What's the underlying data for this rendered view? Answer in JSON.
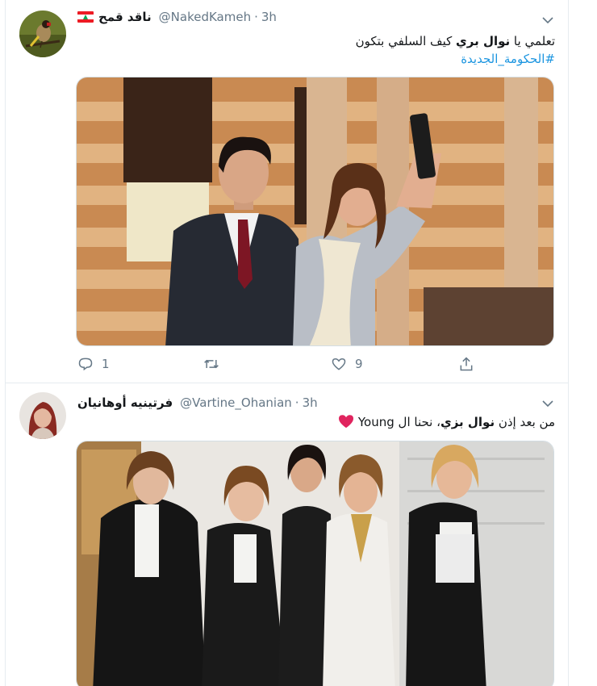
{
  "tweets": [
    {
      "display_name": "ناقد قمح",
      "handle": "@NakedKameh",
      "separator": "·",
      "time": "3h",
      "text_before": "تعلمي يا ",
      "text_bold": "نوال بري",
      "text_after": " كيف السلفي بتكون",
      "hashtag": "#الحكومة_الجديدة",
      "actions": {
        "replies": "1",
        "retweets": "",
        "likes": "9"
      }
    },
    {
      "display_name": "فرتينيه أوهانيان",
      "handle": "@Vartine_Ohanian",
      "separator": "·",
      "time": "3h",
      "text_before": "من بعد إذن ",
      "text_bold": "نوال بزي",
      "text_after": "، نحنا ال Young",
      "emoji": "heart"
    }
  ],
  "colors": {
    "link": "#1b95e0",
    "muted": "#657786",
    "heart": "#e0245e",
    "border": "#e6ecf0"
  },
  "icons": [
    "lebanon-flag-icon",
    "chevron-down-icon",
    "reply-icon",
    "retweet-icon",
    "like-icon",
    "share-icon",
    "red-heart-emoji"
  ]
}
